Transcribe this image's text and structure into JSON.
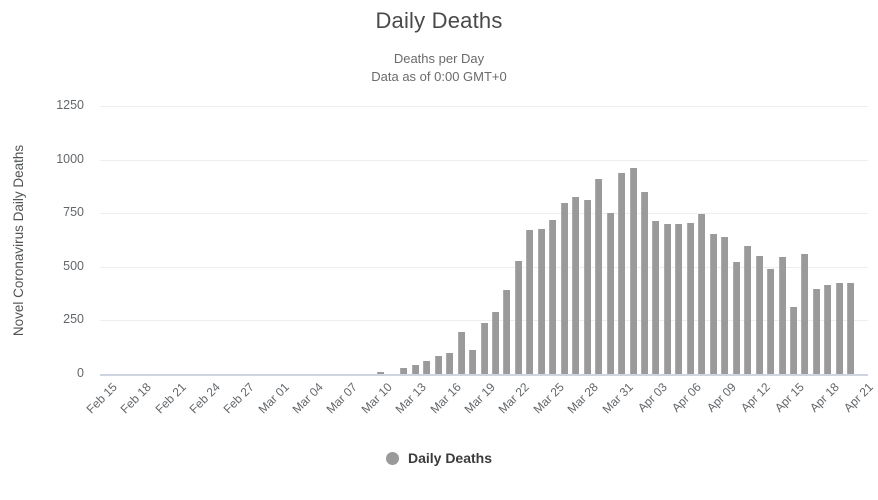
{
  "header": {
    "title": "Daily Deaths",
    "subtitle_line1": "Deaths per Day",
    "subtitle_line2": "Data as of 0:00 GMT+0"
  },
  "legend": {
    "position": "bottom",
    "items": [
      {
        "label": "Daily Deaths",
        "color": "#9a9a9a",
        "marker": "circle-marker"
      }
    ]
  },
  "colors": {
    "bar": "#9a9a9a",
    "bar_edge": "#ababab",
    "gridline": "#eceef0",
    "axis": "#ced4e0",
    "title_text": "#4a4a4a",
    "tick_text": "#63676b"
  },
  "chart_data": {
    "type": "bar",
    "title": "Daily Deaths",
    "subtitle": "Deaths per Day / Data as of 0:00 GMT+0",
    "xlabel": "",
    "ylabel": "Novel Coronavirus Daily Deaths",
    "ylim": [
      0,
      1250
    ],
    "yticks": [
      0,
      250,
      500,
      750,
      1000,
      1250
    ],
    "ytick_labels": [
      "0",
      "250",
      "500",
      "750",
      "1000",
      "1250"
    ],
    "grid": true,
    "xtick_labels": [
      "Feb 15",
      "Feb 18",
      "Feb 21",
      "Feb 24",
      "Feb 27",
      "Mar 01",
      "Mar 04",
      "Mar 07",
      "Mar 10",
      "Mar 13",
      "Mar 16",
      "Mar 19",
      "Mar 22",
      "Mar 25",
      "Mar 28",
      "Mar 31",
      "Apr 03",
      "Apr 06",
      "Apr 09",
      "Apr 12",
      "Apr 15",
      "Apr 18",
      "Apr 21"
    ],
    "xtick_indices": [
      0,
      3,
      6,
      9,
      12,
      15,
      18,
      21,
      24,
      27,
      30,
      33,
      36,
      39,
      42,
      45,
      48,
      51,
      54,
      57,
      60,
      63,
      66
    ],
    "categories": [
      "Feb 15",
      "Feb 16",
      "Feb 17",
      "Feb 18",
      "Feb 19",
      "Feb 20",
      "Feb 21",
      "Feb 22",
      "Feb 23",
      "Feb 24",
      "Feb 25",
      "Feb 26",
      "Feb 27",
      "Feb 28",
      "Feb 29",
      "Mar 01",
      "Mar 02",
      "Mar 03",
      "Mar 04",
      "Mar 05",
      "Mar 06",
      "Mar 07",
      "Mar 08",
      "Mar 09",
      "Mar 10",
      "Mar 11",
      "Mar 12",
      "Mar 13",
      "Mar 14",
      "Mar 15",
      "Mar 16",
      "Mar 17",
      "Mar 18",
      "Mar 19",
      "Mar 20",
      "Mar 21",
      "Mar 22",
      "Mar 23",
      "Mar 24",
      "Mar 25",
      "Mar 26",
      "Mar 27",
      "Mar 28",
      "Mar 29",
      "Mar 30",
      "Mar 31",
      "Apr 01",
      "Apr 02",
      "Apr 03",
      "Apr 04",
      "Apr 05",
      "Apr 06",
      "Apr 07",
      "Apr 08",
      "Apr 09",
      "Apr 10",
      "Apr 11",
      "Apr 12",
      "Apr 13",
      "Apr 14",
      "Apr 15",
      "Apr 16",
      "Apr 17",
      "Apr 18",
      "Apr 19",
      "Apr 20",
      "Apr 21"
    ],
    "series": [
      {
        "name": "Daily Deaths",
        "color": "#9a9a9a",
        "values": [
          0,
          0,
          0,
          0,
          0,
          0,
          0,
          0,
          0,
          0,
          0,
          0,
          0,
          0,
          0,
          0,
          0,
          0,
          0,
          0,
          0,
          0,
          0,
          0,
          8,
          0,
          27,
          41,
          62,
          85,
          97,
          196,
          110,
          240,
          289,
          390,
          529,
          673,
          678,
          718,
          797,
          827,
          812,
          911,
          750,
          938,
          959,
          849,
          714,
          702,
          700,
          706,
          747,
          651,
          639,
          524,
          597,
          550,
          492,
          546,
          311,
          560,
          398,
          416,
          426,
          423
        ]
      }
    ]
  }
}
